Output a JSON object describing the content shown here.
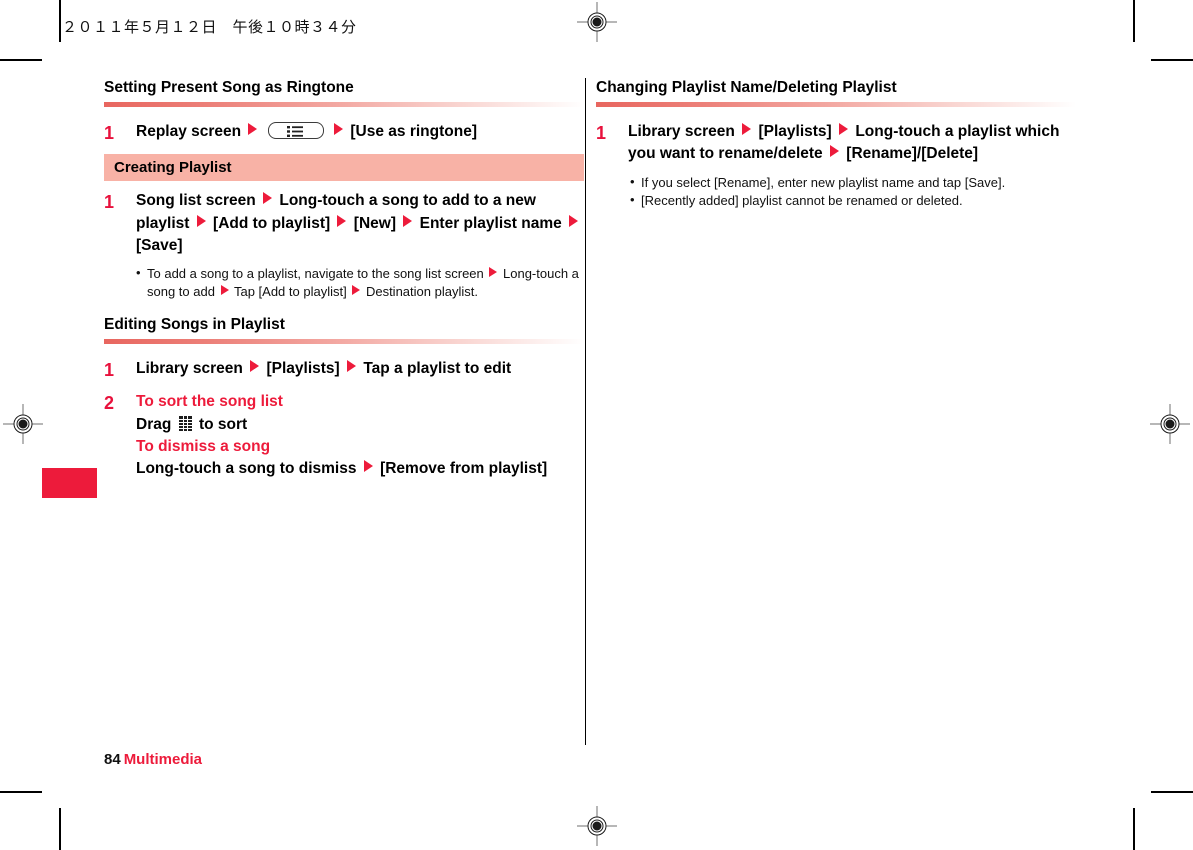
{
  "running_head": "２０１１年５月１２日　午後１０時３４分",
  "colors": {
    "accent_red": "#ed1b3b",
    "rule_red": "#e8665f",
    "subsection_pink": "#f8b2a6",
    "text_black": "#000000"
  },
  "columns": {
    "left": [
      {
        "type": "section",
        "heading": "Setting Present Song as Ringtone",
        "steps": [
          {
            "number": "1",
            "parts": [
              {
                "kind": "text",
                "value": "Replay screen"
              },
              {
                "kind": "arrow"
              },
              {
                "kind": "key-menu"
              },
              {
                "kind": "arrow"
              },
              {
                "kind": "text",
                "value": "[Use as ringtone]"
              }
            ]
          }
        ]
      },
      {
        "type": "subsection",
        "bar_label": "Creating Playlist",
        "steps": [
          {
            "number": "1",
            "parts": [
              {
                "kind": "text",
                "value": "Song list screen"
              },
              {
                "kind": "arrow"
              },
              {
                "kind": "text",
                "value": "Long-touch a song to add to a new playlist"
              },
              {
                "kind": "arrow"
              },
              {
                "kind": "text",
                "value": "[Add to playlist]"
              },
              {
                "kind": "arrow"
              },
              {
                "kind": "text",
                "value": "[New]"
              },
              {
                "kind": "arrow"
              },
              {
                "kind": "text",
                "value": "Enter playlist name"
              },
              {
                "kind": "arrow"
              },
              {
                "kind": "text",
                "value": "[Save]"
              }
            ]
          }
        ],
        "notes": [
          {
            "parts": [
              {
                "kind": "text",
                "value": "To add a song to a playlist, navigate to the song list screen"
              },
              {
                "kind": "arrow-sm"
              },
              {
                "kind": "text",
                "value": "Long-touch a song to add"
              },
              {
                "kind": "arrow-sm"
              },
              {
                "kind": "text",
                "value": "Tap [Add to playlist]"
              },
              {
                "kind": "arrow-sm"
              },
              {
                "kind": "text",
                "value": "Destination playlist."
              }
            ]
          }
        ]
      },
      {
        "type": "section",
        "heading": "Editing Songs in Playlist",
        "steps": [
          {
            "number": "1",
            "parts": [
              {
                "kind": "text",
                "value": "Library screen"
              },
              {
                "kind": "arrow"
              },
              {
                "kind": "text",
                "value": "[Playlists]"
              },
              {
                "kind": "arrow"
              },
              {
                "kind": "text",
                "value": "Tap a playlist to edit"
              }
            ]
          },
          {
            "number": "2",
            "parts": [
              {
                "kind": "sub-label",
                "value": "To sort the song list"
              },
              {
                "kind": "break"
              },
              {
                "kind": "text",
                "value": "Drag"
              },
              {
                "kind": "glyph-drag"
              },
              {
                "kind": "text",
                "value": "to sort"
              },
              {
                "kind": "break"
              },
              {
                "kind": "sub-label",
                "value": "To dismiss a song"
              },
              {
                "kind": "break"
              },
              {
                "kind": "text",
                "value": "Long-touch a song to dismiss"
              },
              {
                "kind": "arrow"
              },
              {
                "kind": "text",
                "value": "[Remove from playlist]"
              }
            ]
          }
        ]
      }
    ],
    "right": [
      {
        "type": "section",
        "heading": "Changing Playlist Name/Deleting Playlist",
        "steps": [
          {
            "number": "1",
            "parts": [
              {
                "kind": "text",
                "value": "Library screen"
              },
              {
                "kind": "arrow"
              },
              {
                "kind": "text",
                "value": "[Playlists]"
              },
              {
                "kind": "arrow"
              },
              {
                "kind": "text",
                "value": "Long-touch a playlist which you want to rename/delete"
              },
              {
                "kind": "arrow"
              },
              {
                "kind": "text",
                "value": "[Rename]/[Delete]"
              }
            ]
          }
        ],
        "notes": [
          {
            "parts": [
              {
                "kind": "text",
                "value": "If you select [Rename], enter new playlist name and tap [Save]."
              }
            ]
          },
          {
            "parts": [
              {
                "kind": "text",
                "value": "[Recently added] playlist cannot be renamed or deleted."
              }
            ]
          }
        ]
      }
    ]
  },
  "footer": {
    "page_number": "84",
    "section_name": "Multimedia"
  }
}
